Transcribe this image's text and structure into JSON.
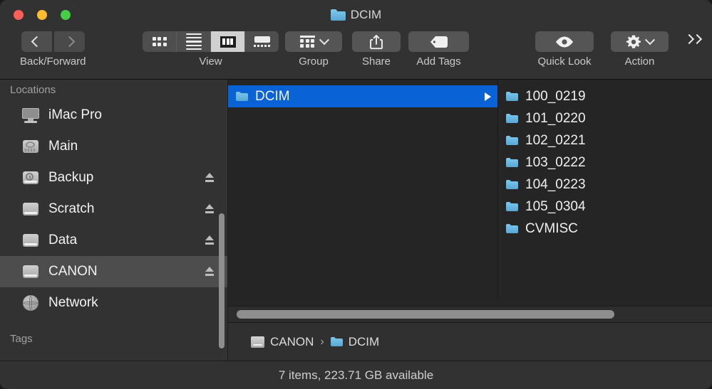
{
  "window": {
    "title": "DCIM",
    "title_icon": "folder-icon",
    "traffic_lights": {
      "close": "close-window-button",
      "minimize": "minimize-window-button",
      "zoom": "zoom-window-button"
    }
  },
  "toolbar": {
    "back_forward_label": "Back/Forward",
    "view_label": "View",
    "group_label": "Group",
    "share_label": "Share",
    "add_tags_label": "Add Tags",
    "quick_look_label": "Quick Look",
    "action_label": "Action",
    "overflow_label": "»",
    "view_options": [
      {
        "name": "icon-view",
        "selected": false
      },
      {
        "name": "list-view",
        "selected": false
      },
      {
        "name": "column-view",
        "selected": true
      },
      {
        "name": "gallery-view",
        "selected": false
      }
    ]
  },
  "sidebar": {
    "sections": [
      {
        "header": "Locations",
        "items": [
          {
            "label": "iMac Pro",
            "icon": "display-icon",
            "eject": false,
            "selected": false
          },
          {
            "label": "Main",
            "icon": "harddisk-icon",
            "eject": false,
            "selected": false
          },
          {
            "label": "Backup",
            "icon": "timemachine-icon",
            "eject": true,
            "selected": false
          },
          {
            "label": "Scratch",
            "icon": "drive-icon",
            "eject": true,
            "selected": false
          },
          {
            "label": "Data",
            "icon": "drive-icon",
            "eject": true,
            "selected": false
          },
          {
            "label": "CANON",
            "icon": "drive-icon",
            "eject": true,
            "selected": true
          },
          {
            "label": "Network",
            "icon": "globe-icon",
            "eject": false,
            "selected": false
          }
        ]
      },
      {
        "header": "Tags",
        "items": []
      }
    ]
  },
  "browser": {
    "columns": [
      {
        "name": "column-1",
        "items": [
          {
            "label": "DCIM",
            "icon": "folder-icon",
            "selected": true,
            "has_children": true
          }
        ]
      },
      {
        "name": "column-2",
        "items": [
          {
            "label": "100_0219",
            "icon": "folder-icon",
            "selected": false,
            "has_children": false
          },
          {
            "label": "101_0220",
            "icon": "folder-icon",
            "selected": false,
            "has_children": false
          },
          {
            "label": "102_0221",
            "icon": "folder-icon",
            "selected": false,
            "has_children": false
          },
          {
            "label": "103_0222",
            "icon": "folder-icon",
            "selected": false,
            "has_children": false
          },
          {
            "label": "104_0223",
            "icon": "folder-icon",
            "selected": false,
            "has_children": false
          },
          {
            "label": "105_0304",
            "icon": "folder-icon",
            "selected": false,
            "has_children": false
          },
          {
            "label": "CVMISC",
            "icon": "folder-icon",
            "selected": false,
            "has_children": false
          }
        ]
      }
    ]
  },
  "path_bar": {
    "crumbs": [
      {
        "label": "CANON",
        "icon": "drive-icon"
      },
      {
        "label": "DCIM",
        "icon": "folder-icon"
      }
    ],
    "separator": "›"
  },
  "status_bar": {
    "text": "7 items, 223.71 GB available"
  },
  "colors": {
    "selection_blue": "#0a63d6",
    "sidebar_selection": "#4d4d4d",
    "window_chrome": "#323232",
    "browser_background": "#252525",
    "folder_blue": "#76c2e9",
    "traffic_close": "#ff5f57",
    "traffic_min": "#febc2e",
    "traffic_max": "#46cf45"
  }
}
